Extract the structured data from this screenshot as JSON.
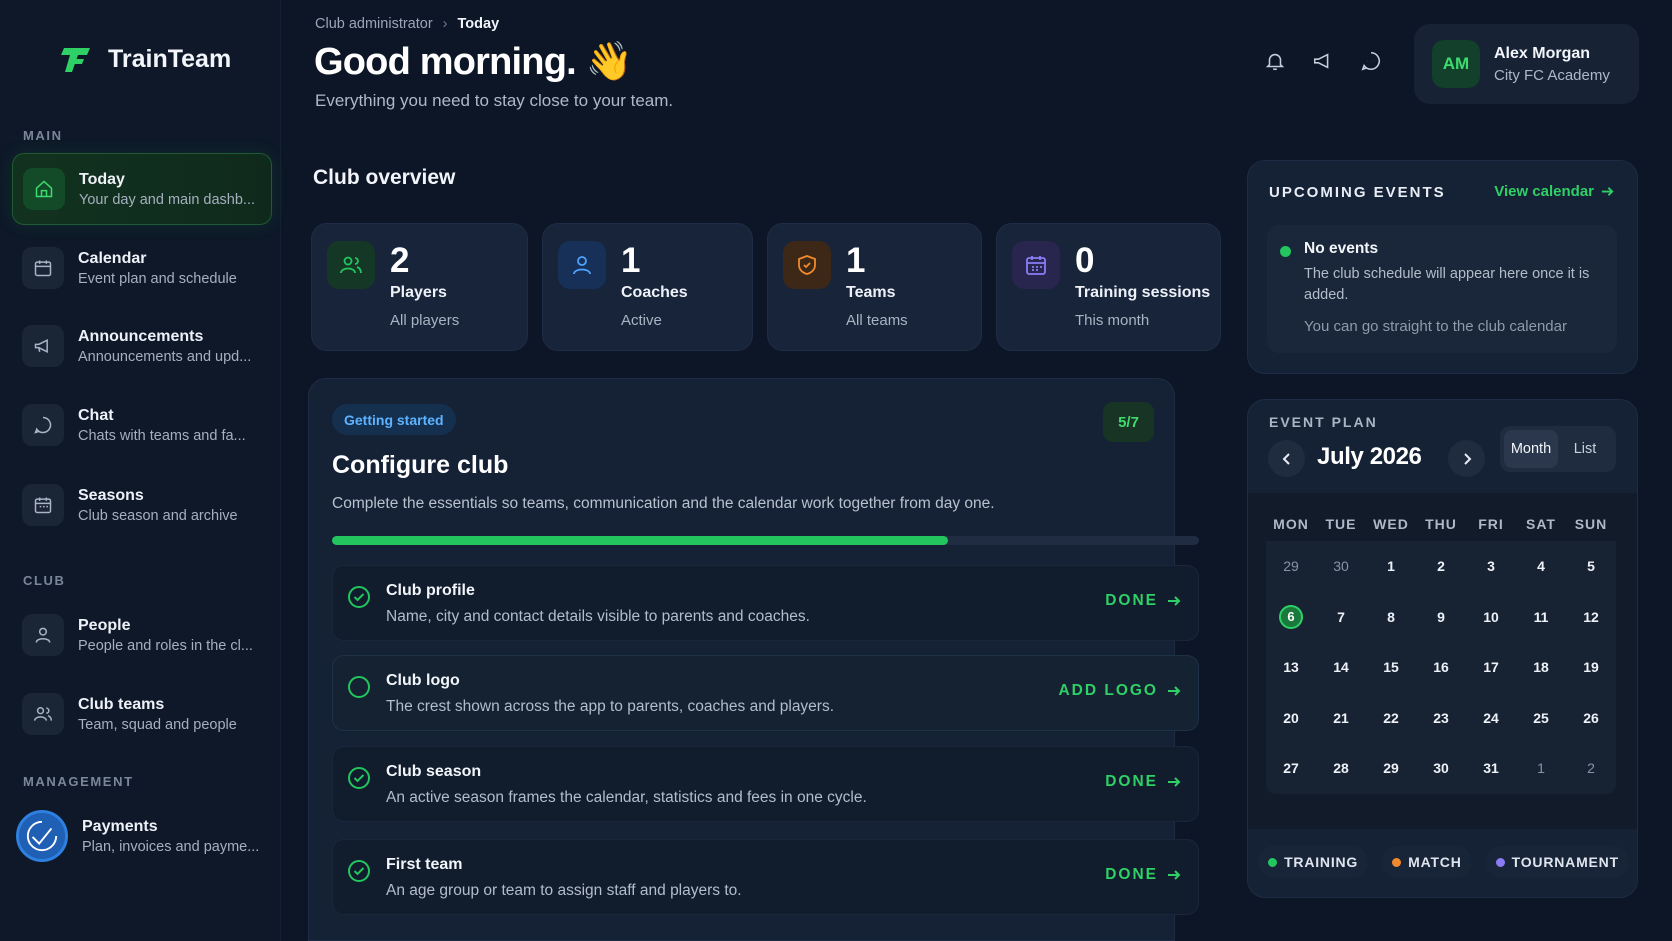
{
  "app": {
    "name": "TrainTeam"
  },
  "sidebar": {
    "sections": {
      "main": "MAIN",
      "club": "CLUB",
      "management": "MANAGEMENT"
    },
    "items": [
      {
        "label": "Today",
        "sub": "Your day and main dashb...",
        "icon": "home-icon"
      },
      {
        "label": "Calendar",
        "sub": "Event plan and schedule",
        "icon": "calendar-icon"
      },
      {
        "label": "Announcements",
        "sub": "Announcements and upd...",
        "icon": "megaphone-icon"
      },
      {
        "label": "Chat",
        "sub": "Chats with teams and fa...",
        "icon": "chat-icon"
      },
      {
        "label": "Seasons",
        "sub": "Club season and archive",
        "icon": "calendar-icon"
      },
      {
        "label": "People",
        "sub": "People and roles in the cl...",
        "icon": "person-icon"
      },
      {
        "label": "Club teams",
        "sub": "Team, squad and people",
        "icon": "people-icon"
      },
      {
        "label": "Payments",
        "sub": "Plan, invoices and payme...",
        "icon": "payment-check-icon"
      }
    ]
  },
  "header": {
    "breadcrumb": [
      "Club administrator",
      "Today"
    ],
    "greeting": "Good morning. 👋",
    "subtitle": "Everything you need to stay close to your team.",
    "user": {
      "initials": "AM",
      "name": "Alex Morgan",
      "org": "City FC Academy"
    }
  },
  "overview": {
    "title": "Club overview",
    "stats": [
      {
        "value": "2",
        "label": "Players",
        "sub": "All players",
        "icon": "players-icon",
        "color": "#22c55e"
      },
      {
        "value": "1",
        "label": "Coaches",
        "sub": "Active",
        "icon": "coach-icon",
        "color": "#4da3ff"
      },
      {
        "value": "1",
        "label": "Teams",
        "sub": "All teams",
        "icon": "shield-icon",
        "color": "#f08a2c"
      },
      {
        "value": "0",
        "label": "Training sessions",
        "sub": "This month",
        "icon": "calendar-icon",
        "color": "#8b7cf6"
      }
    ]
  },
  "configure": {
    "badge": "Getting started",
    "count": "5/7",
    "progress": 0.71,
    "title": "Configure club",
    "description": "Complete the essentials so teams, communication and the calendar work together from day one.",
    "tasks": [
      {
        "title": "Club profile",
        "desc": "Name, city and contact details visible to parents and coaches.",
        "action": "DONE",
        "done": true
      },
      {
        "title": "Club logo",
        "desc": "The crest shown across the app to parents, coaches and players.",
        "action": "ADD LOGO",
        "done": false
      },
      {
        "title": "Club season",
        "desc": "An active season frames the calendar, statistics and fees in one cycle.",
        "action": "DONE",
        "done": true
      },
      {
        "title": "First team",
        "desc": "An age group or team to assign staff and players to.",
        "action": "DONE",
        "done": true
      }
    ]
  },
  "events": {
    "title": "UPCOMING EVENTS",
    "link": "View calendar",
    "empty_title": "No events",
    "empty_desc": "The club schedule will appear here once it is added.",
    "empty_hint": "You can go straight to the club calendar"
  },
  "plan": {
    "title": "EVENT PLAN",
    "month": "July 2026",
    "views": [
      "Month",
      "List"
    ],
    "active_view": "Month",
    "weekdays": [
      "MON",
      "TUE",
      "WED",
      "THU",
      "FRI",
      "SAT",
      "SUN"
    ],
    "days": [
      [
        "29",
        "30",
        "1",
        "2",
        "3",
        "4",
        "5"
      ],
      [
        "6",
        "7",
        "8",
        "9",
        "10",
        "11",
        "12"
      ],
      [
        "13",
        "14",
        "15",
        "16",
        "17",
        "18",
        "19"
      ],
      [
        "20",
        "21",
        "22",
        "23",
        "24",
        "25",
        "26"
      ],
      [
        "27",
        "28",
        "29",
        "30",
        "31",
        "1",
        "2"
      ]
    ],
    "today": "6",
    "legend": [
      {
        "label": "TRAINING",
        "color": "#22c55e"
      },
      {
        "label": "MATCH",
        "color": "#f08a2c"
      },
      {
        "label": "TOURNAMENT",
        "color": "#8b7cf6"
      }
    ]
  }
}
